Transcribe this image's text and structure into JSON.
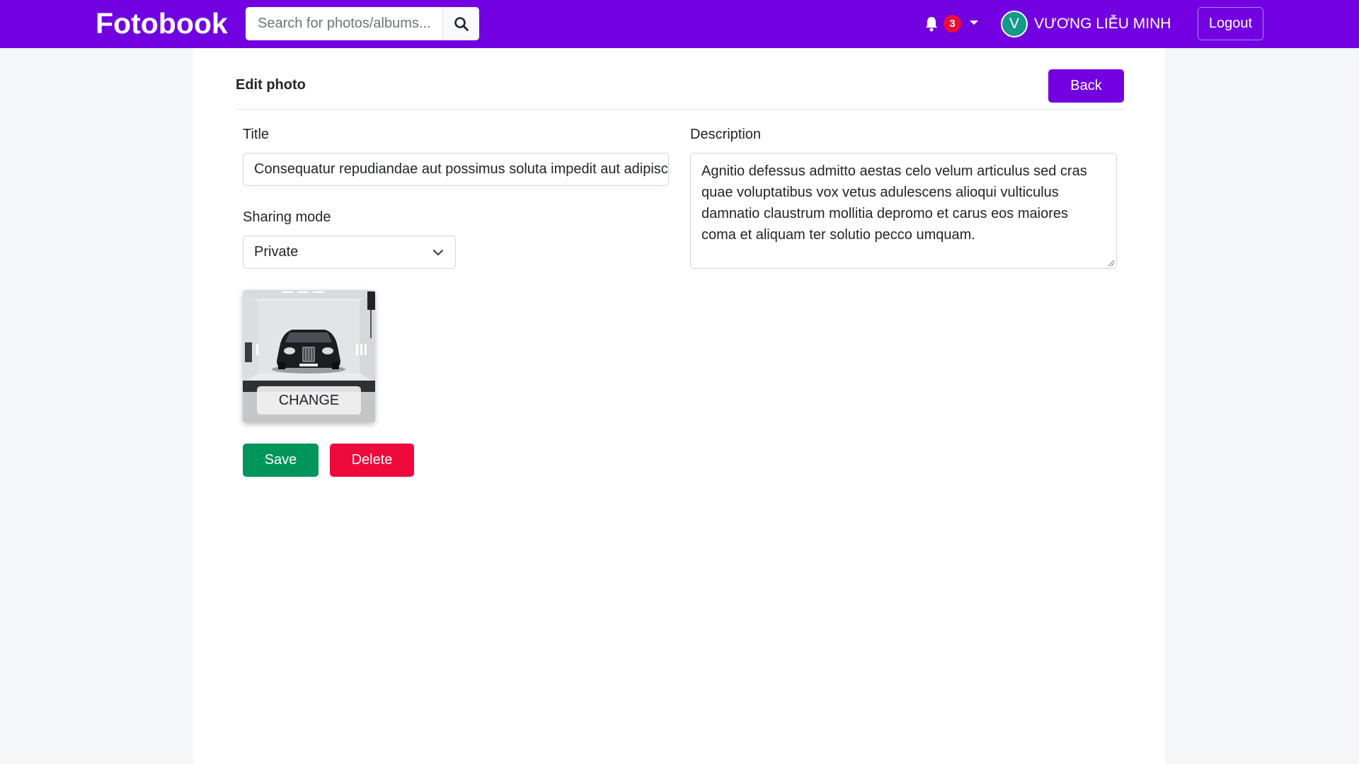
{
  "navbar": {
    "brand": "Fotobook",
    "search": {
      "placeholder": "Search for photos/albums...",
      "value": ""
    },
    "notifications": {
      "count": "3"
    },
    "user": {
      "avatar_initial": "V",
      "name": "VƯƠNG LIỄU MINH"
    },
    "logout_label": "Logout"
  },
  "page": {
    "header_title": "Edit photo",
    "back_label": "Back"
  },
  "form": {
    "title_label": "Title",
    "title_value": "Consequatur repudiandae aut possimus soluta impedit aut adipisci",
    "sharing_label": "Sharing mode",
    "sharing_value": "Private",
    "description_label": "Description",
    "description_value": "Agnitio defessus admitto aestas celo velum articulus sed cras quae voluptatibus vox vetus adulescens alioqui vulticulus damnatio claustrum mollitia depromo et carus eos maiores coma et aliquam ter solutio pecco umquam.",
    "change_label": "CHANGE",
    "save_label": "Save",
    "delete_label": "Delete"
  },
  "colors": {
    "brand": "#7200e0",
    "success": "#00955a",
    "danger": "#ee0a3b",
    "avatar": "#129a8a"
  }
}
